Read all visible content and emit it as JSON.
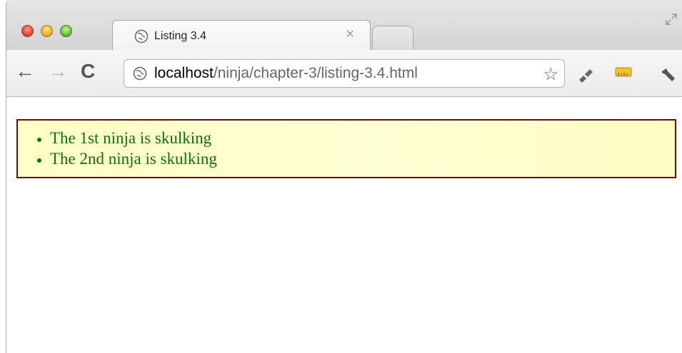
{
  "browser": {
    "tab_title": "Listing 3.4",
    "tab_close": "×",
    "address": {
      "host": "localhost",
      "path": "/ninja/chapter-3/listing-3.4.html"
    },
    "buttons": {
      "back": "←",
      "forward": "→",
      "reload": "C",
      "star": "☆",
      "wrench": "🔧"
    }
  },
  "page": {
    "items": [
      "The 1st ninja is skulking",
      "The 2nd ninja is skulking"
    ]
  },
  "colors": {
    "list_text": "#087508",
    "list_border": "#6b0f0f",
    "list_bg": "#ffffc7"
  }
}
